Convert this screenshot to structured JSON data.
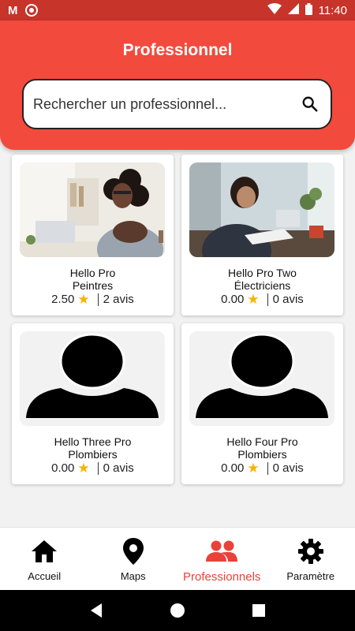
{
  "status_bar": {
    "time": "11:40",
    "icons": [
      "gmail-icon",
      "recording-icon",
      "wifi-icon",
      "signal-icon",
      "battery-icon"
    ]
  },
  "header": {
    "title": "Professionnel",
    "search_placeholder": "Rechercher un professionnel..."
  },
  "colors": {
    "header": "#f24a3d",
    "status_bar": "#c7342a",
    "accent": "#e8423a",
    "star": "#f5b400"
  },
  "professionals": [
    {
      "name": "Hello Pro",
      "category": "Peintres",
      "rating": "2.50",
      "reviews": "2 avis",
      "image": "photo-woman-laptop"
    },
    {
      "name": "Hello Pro Two",
      "category": "Électriciens",
      "rating": "0.00",
      "reviews": "0 avis",
      "image": "photo-woman-phone"
    },
    {
      "name": "Hello Three Pro",
      "category": "Plombiers",
      "rating": "0.00",
      "reviews": "0 avis",
      "image": "default-avatar"
    },
    {
      "name": "Hello Four Pro",
      "category": "Plombiers",
      "rating": "0.00",
      "reviews": "0 avis",
      "image": "default-avatar"
    }
  ],
  "bottom_nav": {
    "active": "Professionnels",
    "items": [
      {
        "label": "Accueil",
        "icon": "home-icon"
      },
      {
        "label": "Maps",
        "icon": "map-pin-icon"
      },
      {
        "label": "Professionnels",
        "icon": "people-icon"
      },
      {
        "label": "Paramètre",
        "icon": "settings-gear-icon"
      }
    ]
  },
  "system_nav": [
    "back-icon",
    "home-circle-icon",
    "recents-icon"
  ]
}
